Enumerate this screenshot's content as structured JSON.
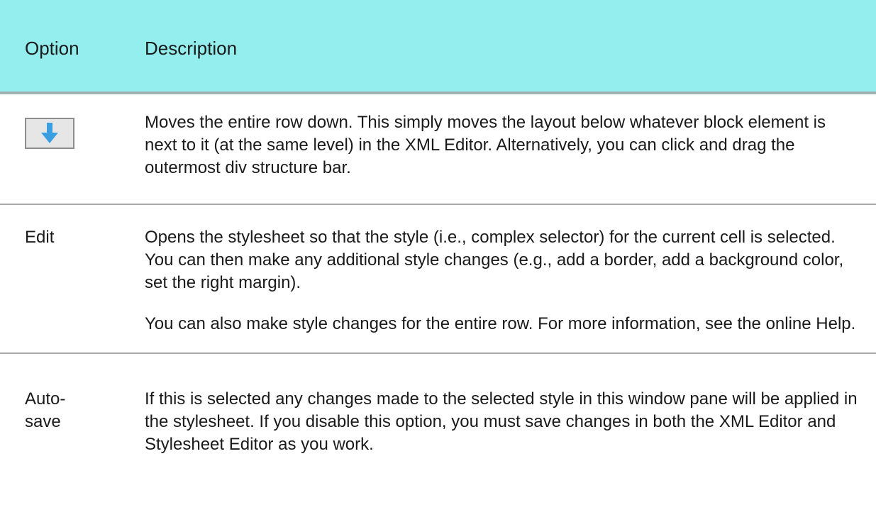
{
  "header": {
    "option": "Option",
    "description": "Description"
  },
  "rows": [
    {
      "option_icon": "arrow-down-icon",
      "description": [
        "Moves the entire row down. This simply moves the layout below whatever block element is next to it (at the same level) in the XML Editor. Alternatively, you can click and drag the outermost div structure bar."
      ]
    },
    {
      "option": "Edit",
      "description": [
        "Opens the stylesheet so that the style (i.e., complex selector) for the current cell is selected. You can then make any additional style changes (e.g., add a border, add a background color, set the right margin).",
        "You can also make style changes for the entire row. For more information, see the online Help."
      ]
    },
    {
      "option": "Auto-save",
      "description": [
        "If this is selected any changes made to the selected style in this window pane will be applied in the stylesheet. If you disable this option, you must save changes in both the XML Editor and Stylesheet Editor as you work."
      ]
    }
  ],
  "colors": {
    "header_bg": "#94eeed",
    "arrow": "#3a9ee0",
    "button_bg": "#e6e6e6"
  }
}
